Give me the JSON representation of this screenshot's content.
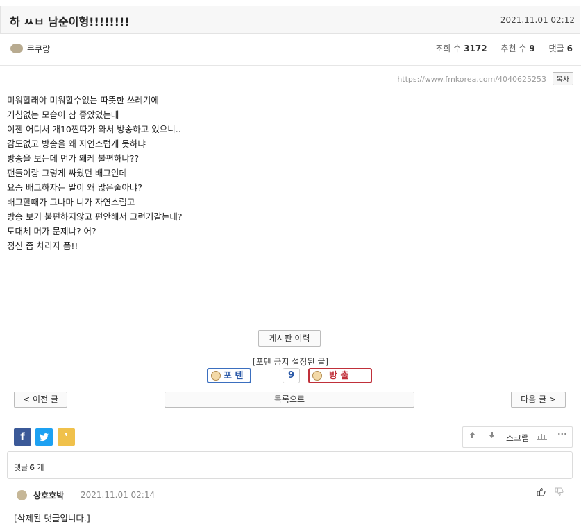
{
  "post": {
    "title": "하 ㅆㅂ 남순이형!!!!!!!!",
    "date": "2021.11.01 02:12",
    "author": "쿠쿠랑",
    "views_label": "조회 수",
    "views": "3172",
    "recommend_label": "추천 수",
    "recommend": "9",
    "comments_label": "댓글",
    "comments": "6",
    "url": "https://www.fmkorea.com/4040625253",
    "copy_label": "복사",
    "body": [
      "미워할래야 미워할수없는 따뜻한 쓰레기에",
      "거침없는 모습이 참 좋았었는데",
      "이젠 어디서 개10찐따가 와서 방송하고 있으니..",
      "",
      "감도없고 방송을 왜 자연스럽게 못하냐",
      "방송을 보는데 먼가 왜케 불편하냐??",
      "",
      "팬들이랑 그렇게 싸웠던 배그인데",
      "요즘 배그하자는 말이 왜 많은줄아냐?",
      "배그할때가 그나마 니가 자연스럽고",
      "방송 보기 불편하지않고 편안해서 그런거같는데?",
      "",
      "도대체 머가 문제냐? 어?",
      "정신 좀 차리자 폼!!"
    ]
  },
  "actions": {
    "history_label": "게시판 이력",
    "ban_label": "[포텐 금지 설정된 글]",
    "vote_up_label": "포 텐",
    "vote_count": "9",
    "vote_down_label": "방 출",
    "prev_label": "< 이전 글",
    "list_label": "목록으로",
    "next_label": "다음 글 >"
  },
  "share": {
    "facebook": "f",
    "twitter": "t",
    "kakao": "❜",
    "scrap_label": "스크랩"
  },
  "comments_section": {
    "header_label": "댓글",
    "count": "6",
    "unit": "개",
    "items": [
      {
        "author": "상호호박",
        "date": "2021.11.01 02:14",
        "text": "[삭제된 댓글입니다.]"
      }
    ]
  },
  "colors": {
    "vote_up": "#3b6fbf",
    "vote_down": "#c0303a",
    "facebook": "#3b5998",
    "twitter": "#1da1f2",
    "kakao": "#f0c14b"
  }
}
